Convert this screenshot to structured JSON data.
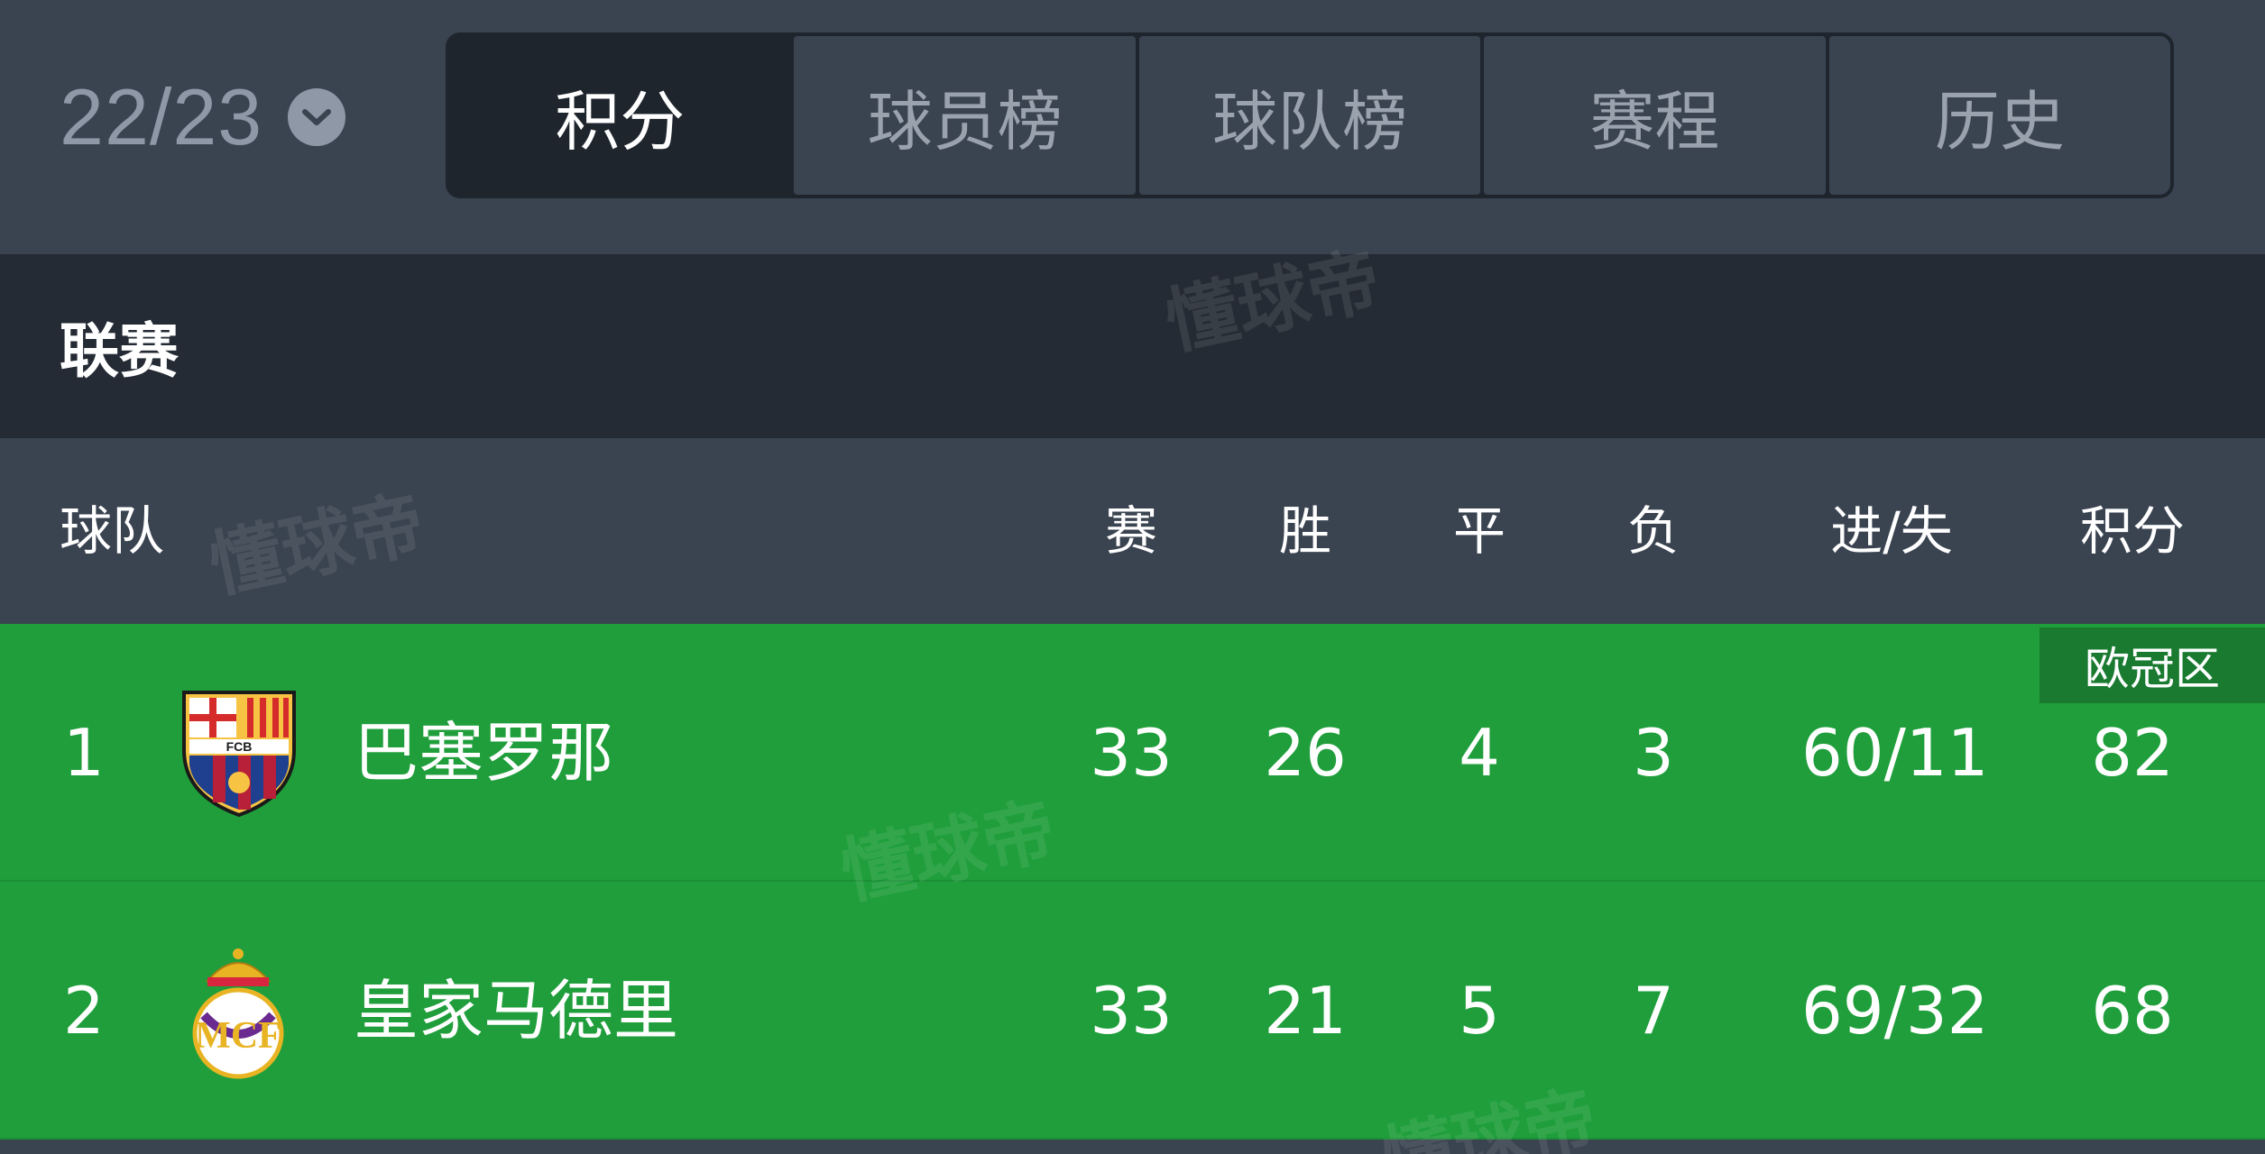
{
  "season": {
    "label": "22/23"
  },
  "tabs": [
    "积分",
    "球员榜",
    "球队榜",
    "赛程",
    "历史"
  ],
  "section": {
    "title": "联赛"
  },
  "columns": {
    "team": "球队",
    "played": "赛",
    "win": "胜",
    "draw": "平",
    "loss": "负",
    "goals": "进/失",
    "points": "积分"
  },
  "zone_badge": "欧冠区",
  "rows": [
    {
      "rank": "1",
      "team": "巴塞罗那",
      "logo": "fc-barcelona-crest-icon",
      "played": "33",
      "win": "26",
      "draw": "4",
      "loss": "3",
      "goals": "60/11",
      "points": "82"
    },
    {
      "rank": "2",
      "team": "皇家马德里",
      "logo": "real-madrid-crest-icon",
      "played": "33",
      "win": "21",
      "draw": "5",
      "loss": "7",
      "goals": "69/32",
      "points": "68"
    }
  ],
  "colors": {
    "header_bg": "#3a4350",
    "section_bg": "#252b34",
    "row_green": "#1f9e3b",
    "zone_badge": "#197a30",
    "muted_text": "#8f98a6"
  },
  "watermark": "懂球帝"
}
